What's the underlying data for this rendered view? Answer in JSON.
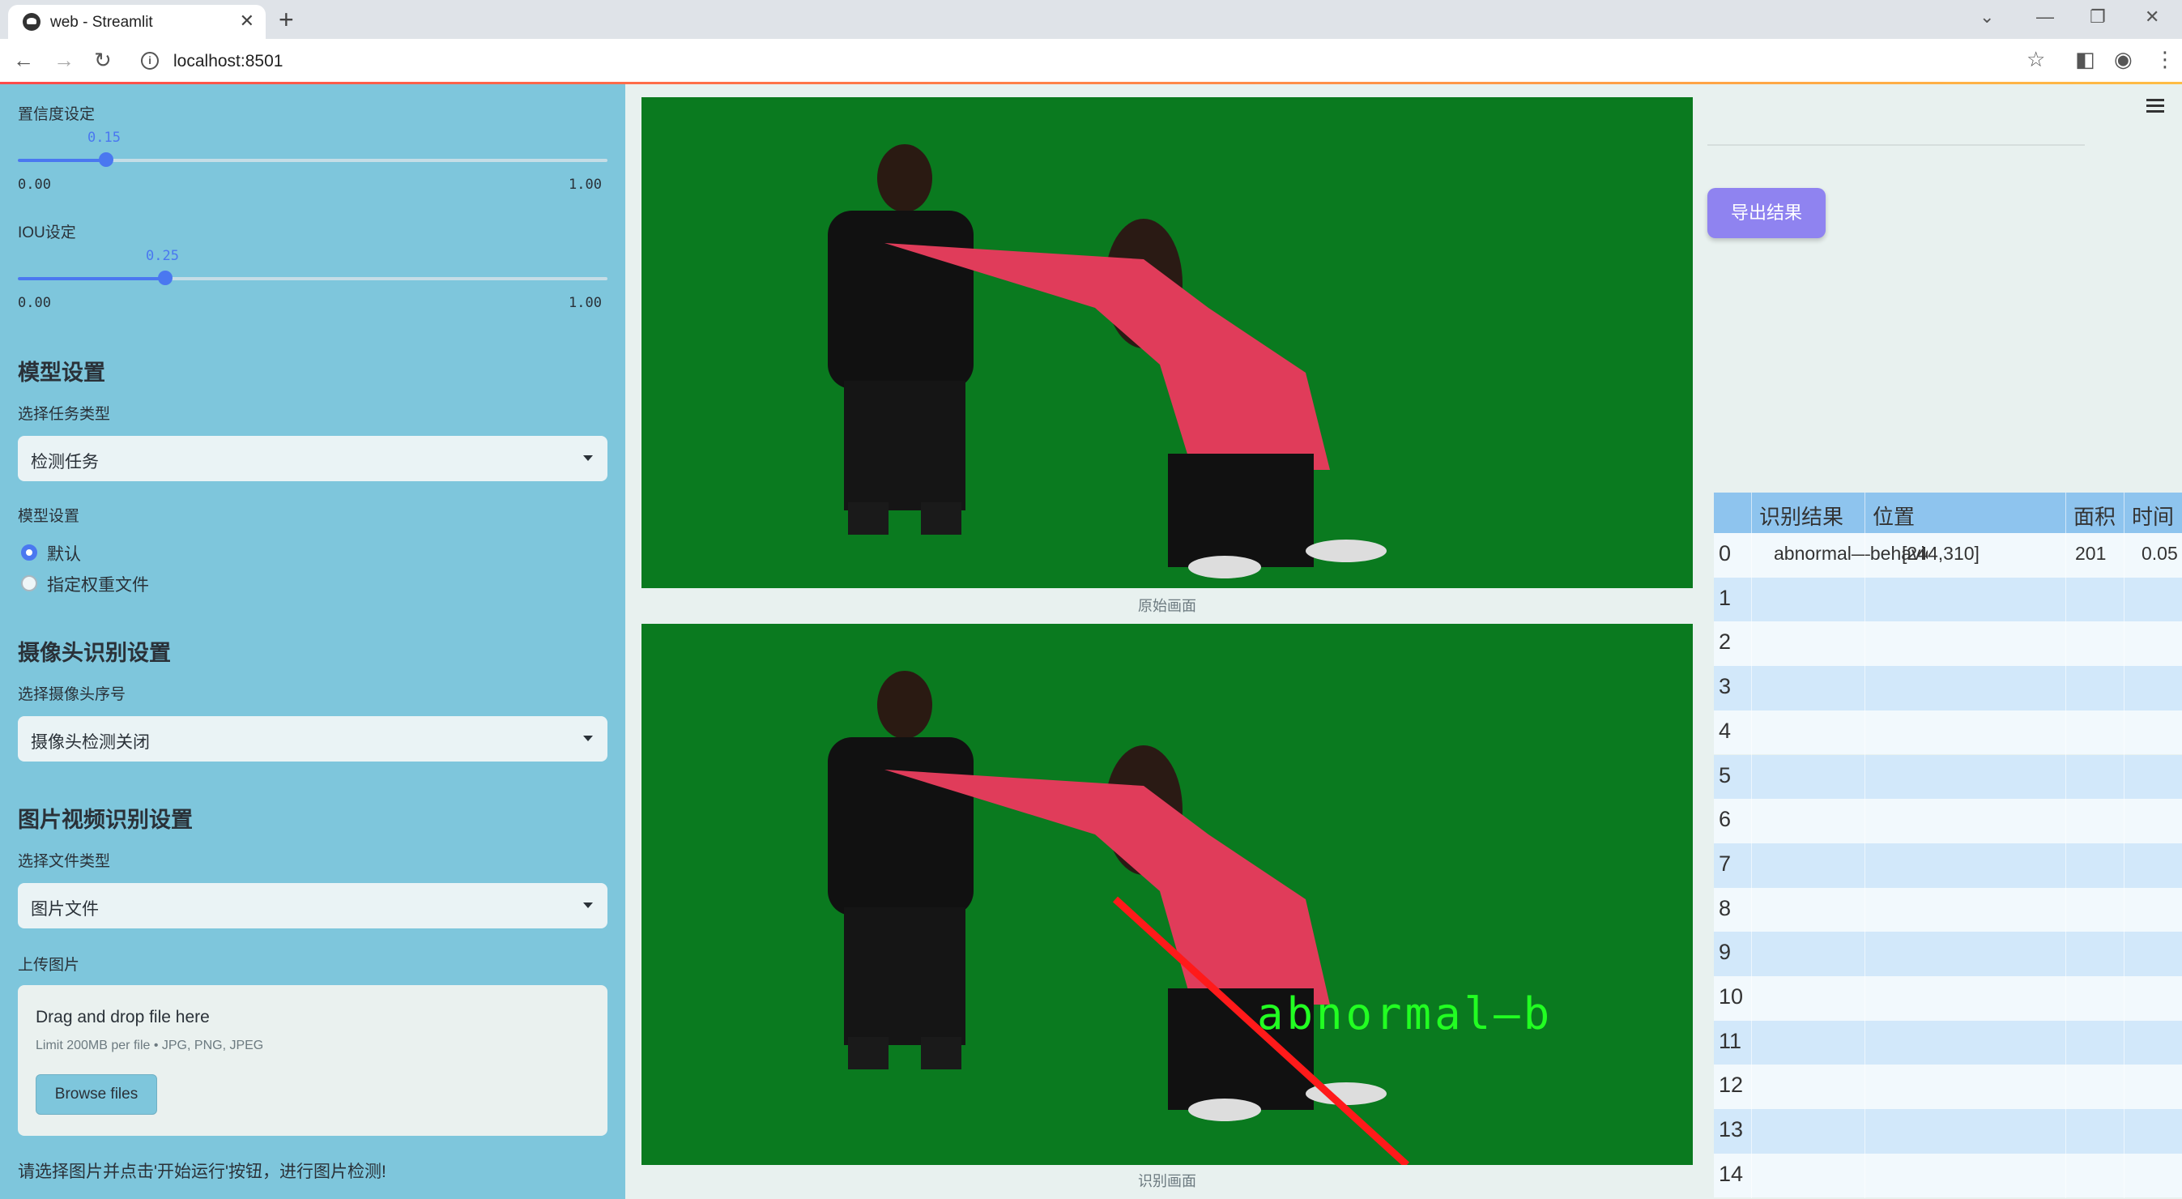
{
  "browser": {
    "tab_title": "web - Streamlit",
    "url": "localhost:8501"
  },
  "sidebar": {
    "confidence": {
      "label": "置信度设定",
      "value": "0.15",
      "min": "0.00",
      "max": "1.00",
      "fraction": 0.15
    },
    "iou": {
      "label": "IOU设定",
      "value": "0.25",
      "min": "0.00",
      "max": "1.00",
      "fraction": 0.25
    },
    "model_section": {
      "heading": "模型设置",
      "task_label": "选择任务类型",
      "task_value": "检测任务",
      "model_label": "模型设置",
      "options": [
        "默认",
        "指定权重文件"
      ],
      "selected": 0
    },
    "camera_section": {
      "heading": "摄像头识别设置",
      "camera_label": "选择摄像头序号",
      "camera_value": "摄像头检测关闭"
    },
    "file_section": {
      "heading": "图片视频识别设置",
      "type_label": "选择文件类型",
      "type_value": "图片文件",
      "upload_label": "上传图片",
      "drop_text": "Drag and drop file here",
      "limit_text": "Limit 200MB per file • JPG, PNG, JPEG",
      "browse_label": "Browse files"
    },
    "status_text": "请选择图片并点击'开始运行'按钮，进行图片检测!"
  },
  "main": {
    "original_caption": "原始画面",
    "result_caption": "识别画面",
    "detection_label": "abnormal—b",
    "export_label": "导出结果"
  },
  "table": {
    "headers": [
      "识别结果",
      "位置",
      "面积",
      "时间"
    ],
    "indices": [
      "0",
      "1",
      "2",
      "3",
      "4",
      "5",
      "6",
      "7",
      "8",
      "9",
      "10",
      "11",
      "12",
      "13",
      "14"
    ],
    "rows": [
      {
        "result": "abnormal—behavior",
        "position": "[244,310]",
        "area": "201",
        "time": "0.05"
      }
    ]
  },
  "colors": {
    "sidebar_bg": "#7ec6dc",
    "accent": "#4a78f0",
    "export_button": "#8f83f0",
    "video_bg": "#0a7a1f",
    "detection_box": "#ff1a1a",
    "detection_text": "#22ff22"
  }
}
